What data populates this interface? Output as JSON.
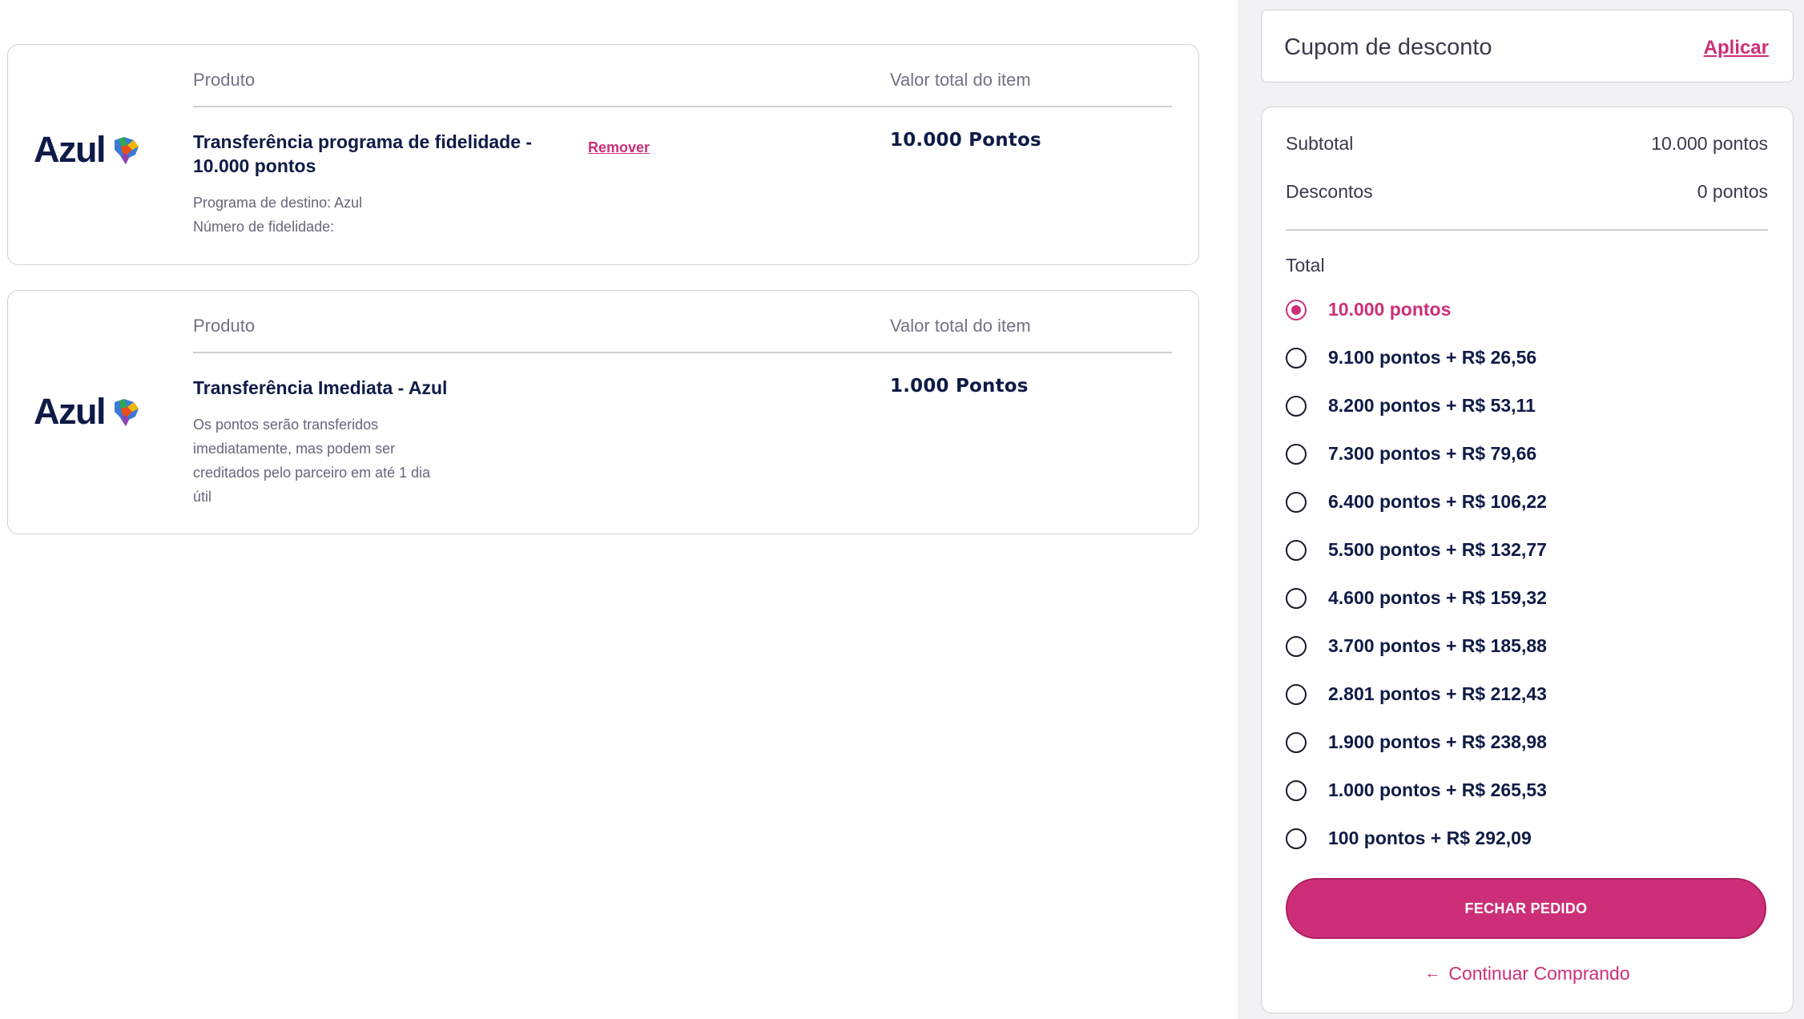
{
  "colors": {
    "accent": "#cc2f78",
    "text_dark": "#0f1b47",
    "text_muted": "#727282",
    "panel_bg": "#f2f2f4"
  },
  "cart": {
    "items": [
      {
        "logo": "Azul",
        "product_header": "Produto",
        "value_header": "Valor total do item",
        "name": "Transferência programa de fidelidade - 10.000 pontos",
        "remove_label": "Remover",
        "details": [
          "Programa de destino: Azul",
          "Número de fidelidade:"
        ],
        "value": "10.000 Pontos"
      },
      {
        "logo": "Azul",
        "product_header": "Produto",
        "value_header": "Valor total do item",
        "name": "Transferência Imediata - Azul",
        "description": "Os pontos serão transferidos imediatamente, mas podem ser creditados pelo parceiro em até 1 dia útil",
        "value": "1.000 Pontos"
      }
    ]
  },
  "coupon": {
    "label": "Cupom de desconto",
    "apply_label": "Aplicar"
  },
  "summary": {
    "subtotal_label": "Subtotal",
    "subtotal_value": "10.000 pontos",
    "discounts_label": "Descontos",
    "discounts_value": "0 pontos",
    "total_label": "Total",
    "options": [
      {
        "label": "10.000 pontos",
        "selected": true
      },
      {
        "label": "9.100 pontos + R$ 26,56",
        "selected": false
      },
      {
        "label": "8.200 pontos + R$ 53,11",
        "selected": false
      },
      {
        "label": "7.300 pontos + R$ 79,66",
        "selected": false
      },
      {
        "label": "6.400 pontos + R$ 106,22",
        "selected": false
      },
      {
        "label": "5.500 pontos + R$ 132,77",
        "selected": false
      },
      {
        "label": "4.600 pontos + R$ 159,32",
        "selected": false
      },
      {
        "label": "3.700 pontos + R$ 185,88",
        "selected": false
      },
      {
        "label": "2.801 pontos + R$ 212,43",
        "selected": false
      },
      {
        "label": "1.900 pontos + R$ 238,98",
        "selected": false
      },
      {
        "label": "1.000 pontos + R$ 265,53",
        "selected": false
      },
      {
        "label": "100 pontos + R$ 292,09",
        "selected": false
      }
    ],
    "checkout_label": "FECHAR PEDIDO",
    "continue_icon": "arrow-left-icon",
    "continue_label": "Continuar Comprando"
  }
}
